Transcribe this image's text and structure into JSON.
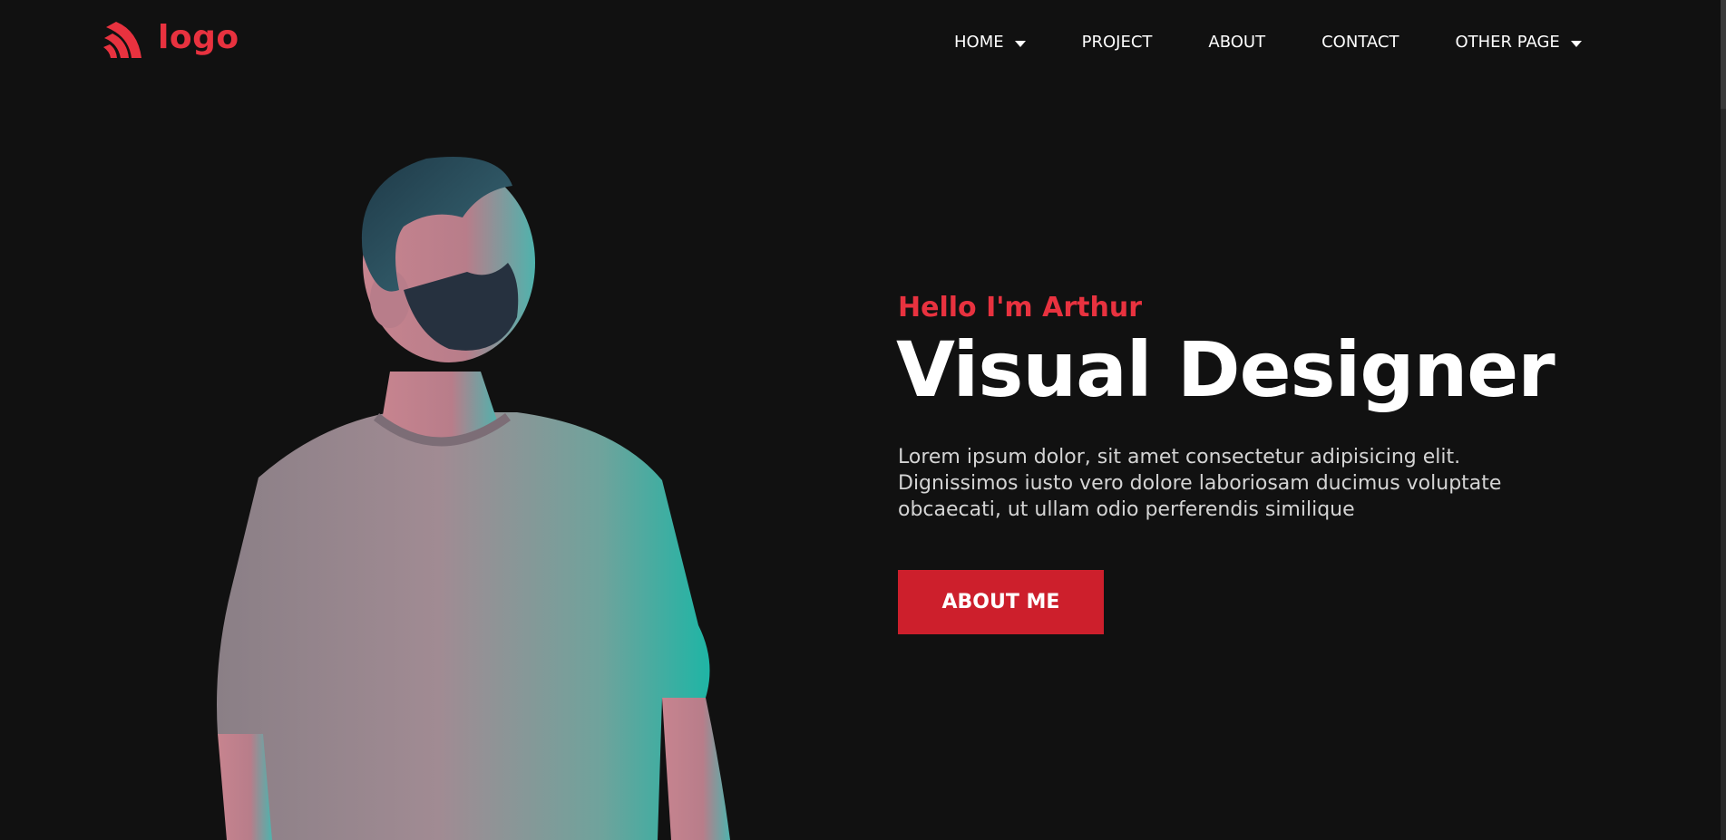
{
  "header": {
    "logo_text": "logo",
    "nav": [
      {
        "label": "HOME",
        "has_dropdown": true
      },
      {
        "label": "PROJECT",
        "has_dropdown": false
      },
      {
        "label": "ABOUT",
        "has_dropdown": false
      },
      {
        "label": "CONTACT",
        "has_dropdown": false
      },
      {
        "label": "OTHER PAGE",
        "has_dropdown": true
      }
    ]
  },
  "hero": {
    "greeting": "Hello I'm Arthur",
    "headline": "Visual Designer",
    "description": "Lorem ipsum dolor, sit amet consectetur adipisicing elit. Dignissimos iusto vero dolore laboriosam ducimus voluptate obcaecati, ut ullam odio perferendis similique",
    "cta_label": "ABOUT ME",
    "image_icon": "bearded-man-portrait"
  },
  "colors": {
    "background": "#111111",
    "accent": "#e8323f",
    "button": "#cd1f2c",
    "text": "#ffffff",
    "muted_text": "#d4d4d4"
  }
}
